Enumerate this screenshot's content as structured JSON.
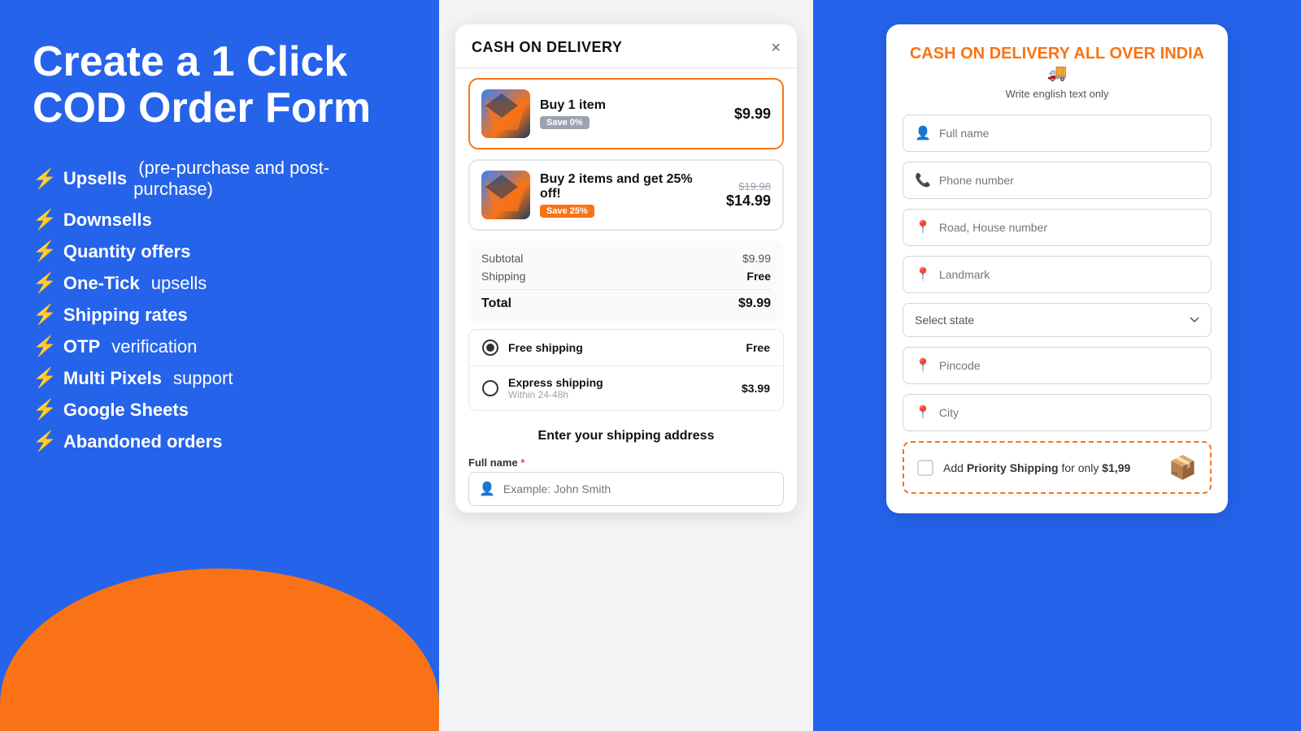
{
  "left": {
    "title": "Create a 1 Click COD Order Form",
    "features": [
      {
        "bold": "Upsells",
        "rest": " (pre-purchase and post-purchase)"
      },
      {
        "bold": "Downsells",
        "rest": ""
      },
      {
        "bold": "Quantity offers",
        "rest": ""
      },
      {
        "bold": "One-Tick",
        "rest": " upsells"
      },
      {
        "bold": "Shipping rates",
        "rest": ""
      },
      {
        "bold": "OTP",
        "rest": " verification"
      },
      {
        "bold": "Multi Pixels",
        "rest": " support"
      },
      {
        "bold": "Google Sheets",
        "rest": ""
      },
      {
        "bold": "Abandoned orders",
        "rest": ""
      }
    ]
  },
  "modal": {
    "title": "CASH ON DELIVERY",
    "close": "×",
    "options": [
      {
        "name": "Buy 1 item",
        "badge": "Save 0%",
        "badge_color": "gray",
        "price": "$9.99",
        "original": "",
        "selected": true
      },
      {
        "name": "Buy 2 items and get 25% off!",
        "badge": "Save 25%",
        "badge_color": "orange",
        "price": "$14.99",
        "original": "$19.98",
        "selected": false
      }
    ],
    "summary": {
      "subtotal_label": "Subtotal",
      "subtotal_value": "$9.99",
      "shipping_label": "Shipping",
      "shipping_value": "Free",
      "total_label": "Total",
      "total_value": "$9.99"
    },
    "shipping_options": [
      {
        "name": "Free shipping",
        "sub": "",
        "price": "Free",
        "checked": true
      },
      {
        "name": "Express shipping",
        "sub": "Within 24-48h",
        "price": "$3.99",
        "checked": false
      }
    ],
    "address_header": "Enter your shipping address",
    "form": {
      "full_name_label": "Full name",
      "full_name_required": "*",
      "full_name_placeholder": "Example: John Smith"
    }
  },
  "right_form": {
    "title": "CASH ON DELIVERY ALL OVER INDIA 🚚",
    "subtitle": "Write english text only",
    "fields": [
      {
        "icon": "person",
        "placeholder": "Full name"
      },
      {
        "icon": "phone",
        "placeholder": "Phone number"
      },
      {
        "icon": "pin",
        "placeholder": "Road, House number"
      },
      {
        "icon": "pin",
        "placeholder": "Landmark"
      }
    ],
    "state_select": {
      "placeholder": "Select state"
    },
    "pincode_placeholder": "Pincode",
    "city_placeholder": "City",
    "priority": {
      "text_before": "Add ",
      "bold": "Priority Shipping",
      "text_after": " for only ",
      "price": "$1,99",
      "icon": "📦"
    }
  }
}
